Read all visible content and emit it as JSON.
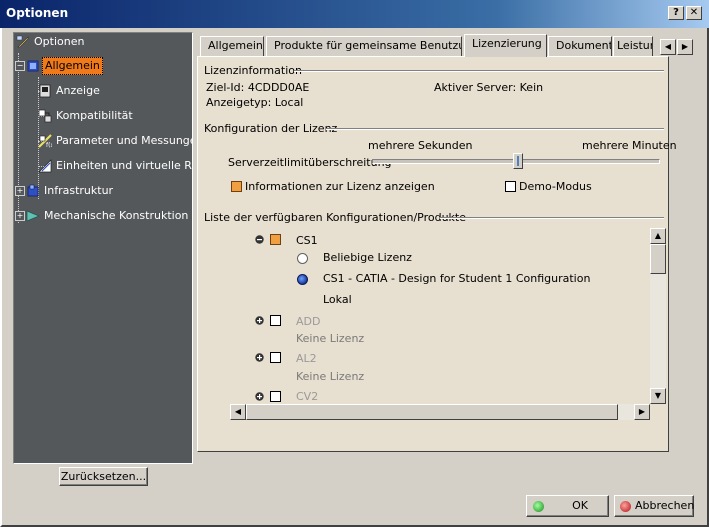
{
  "window": {
    "title": "Optionen",
    "help_btn": "?",
    "close_btn": "✕"
  },
  "tree": {
    "items": [
      {
        "label": "Optionen",
        "icon": "options-root-icon"
      },
      {
        "label": "Allgemein",
        "icon": "general-icon",
        "selected": true
      },
      {
        "label": "Anzeige",
        "icon": "display-icon"
      },
      {
        "label": "Kompatibilität",
        "icon": "compatibility-icon"
      },
      {
        "label": "Parameter und Messungen",
        "icon": "parameters-icon"
      },
      {
        "label": "Einheiten und virtuelle Realität",
        "icon": "units-vr-icon"
      },
      {
        "label": "Infrastruktur",
        "icon": "infrastructure-icon"
      },
      {
        "label": "Mechanische Konstruktion",
        "icon": "mechanical-design-icon"
      }
    ],
    "reset_label": "Zurücksetzen..."
  },
  "tabs": [
    {
      "label": "Allgemein"
    },
    {
      "label": "Produkte für gemeinsame Benutzung"
    },
    {
      "label": "Lizenzierung",
      "active": true
    },
    {
      "label": "Dokument"
    },
    {
      "label": "Leistung"
    }
  ],
  "license_info": {
    "heading": "Lizenzinformation",
    "target_id": "Ziel-Id: 4CDDD0AE",
    "display_type": "Anzeigetyp: Local",
    "active_server": "Aktiver Server: Kein"
  },
  "license_config": {
    "heading": "Konfiguration der Lizenz",
    "slider_left": "mehrere Sekunden",
    "slider_right": "mehrere Minuten",
    "slider_label": "Serverzeitlimitüberschreitung",
    "slider_value": 0.51,
    "show_info_label": "Informationen zur Lizenz anzeigen",
    "show_info_checked": true,
    "demo_label": "Demo-Modus",
    "demo_checked": false
  },
  "config_list": {
    "heading": "Liste der verfügbaren Konfigurationen/Produkte",
    "cs1": "CS1",
    "any_license": "Beliebige Lizenz",
    "cs1_config": "CS1 - CATIA - Design for Student 1 Configuration",
    "local": "Lokal",
    "add": "ADD",
    "add_sub": "Keine Lizenz",
    "al2": "AL2",
    "al2_sub": "Keine Lizenz",
    "cv2": "CV2"
  },
  "footer": {
    "ok": "OK",
    "cancel": "Abbrechen"
  },
  "colors": {
    "selection": "#f07a1a",
    "tree_bg": "#54585a",
    "panel_bg": "#e7dfcf"
  }
}
